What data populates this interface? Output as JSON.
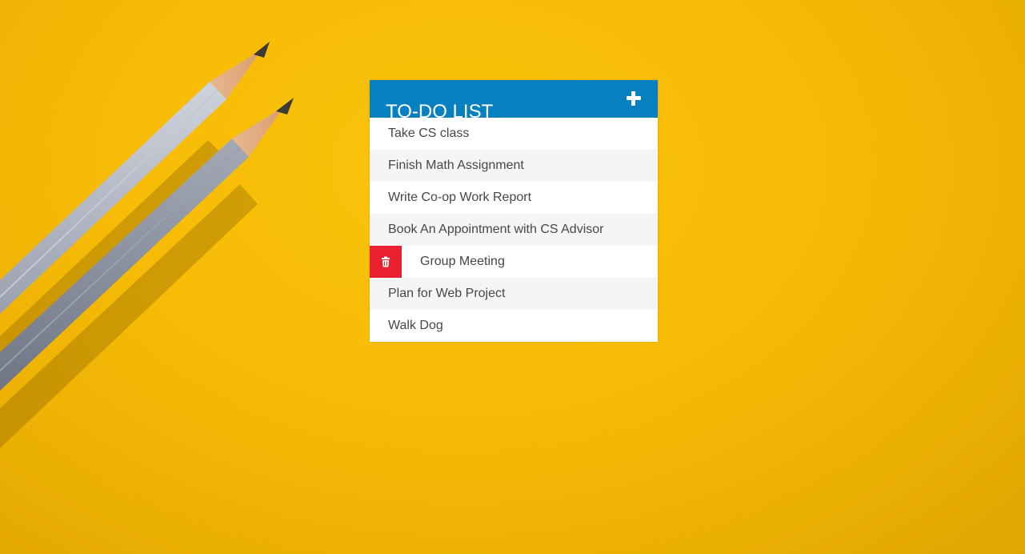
{
  "colors": {
    "background": "#f6bb06",
    "header": "#0780c0",
    "delete": "#ec2130",
    "text": "#474747",
    "stripe": "#f5f5f5"
  },
  "todo": {
    "title": "TO-DO LIST",
    "add_icon": "plus-icon",
    "delete_icon": "trash-icon",
    "items": [
      {
        "text": "Take CS class",
        "hovered": false
      },
      {
        "text": "Finish Math Assignment",
        "hovered": false
      },
      {
        "text": "Write Co-op Work Report",
        "hovered": false
      },
      {
        "text": "Book An Appointment with CS Advisor",
        "hovered": false
      },
      {
        "text": "Group Meeting",
        "hovered": true
      },
      {
        "text": "Plan for Web Project",
        "hovered": false
      },
      {
        "text": "Walk Dog",
        "hovered": false
      }
    ]
  }
}
